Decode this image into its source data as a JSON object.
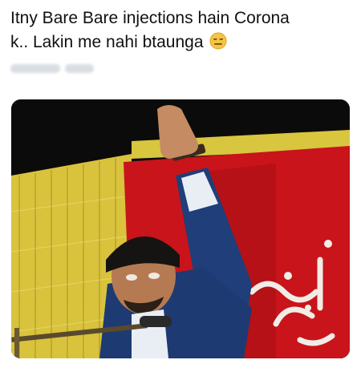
{
  "post": {
    "caption_line1": "Itny Bare Bare injections hain Corona",
    "caption_line2": "k.. Lakin me nahi btaunga",
    "caption_emoji": "expressionless-face-emoji",
    "author_name_blurred": "",
    "media": {
      "type": "photo",
      "description_icon": "meme-photo"
    }
  },
  "colors": {
    "background": "#ffffff",
    "text": "#111111",
    "banner_red": "#c8141a",
    "banner_yellow": "#e8d34a",
    "jacket_blue": "#1f3e7a"
  }
}
